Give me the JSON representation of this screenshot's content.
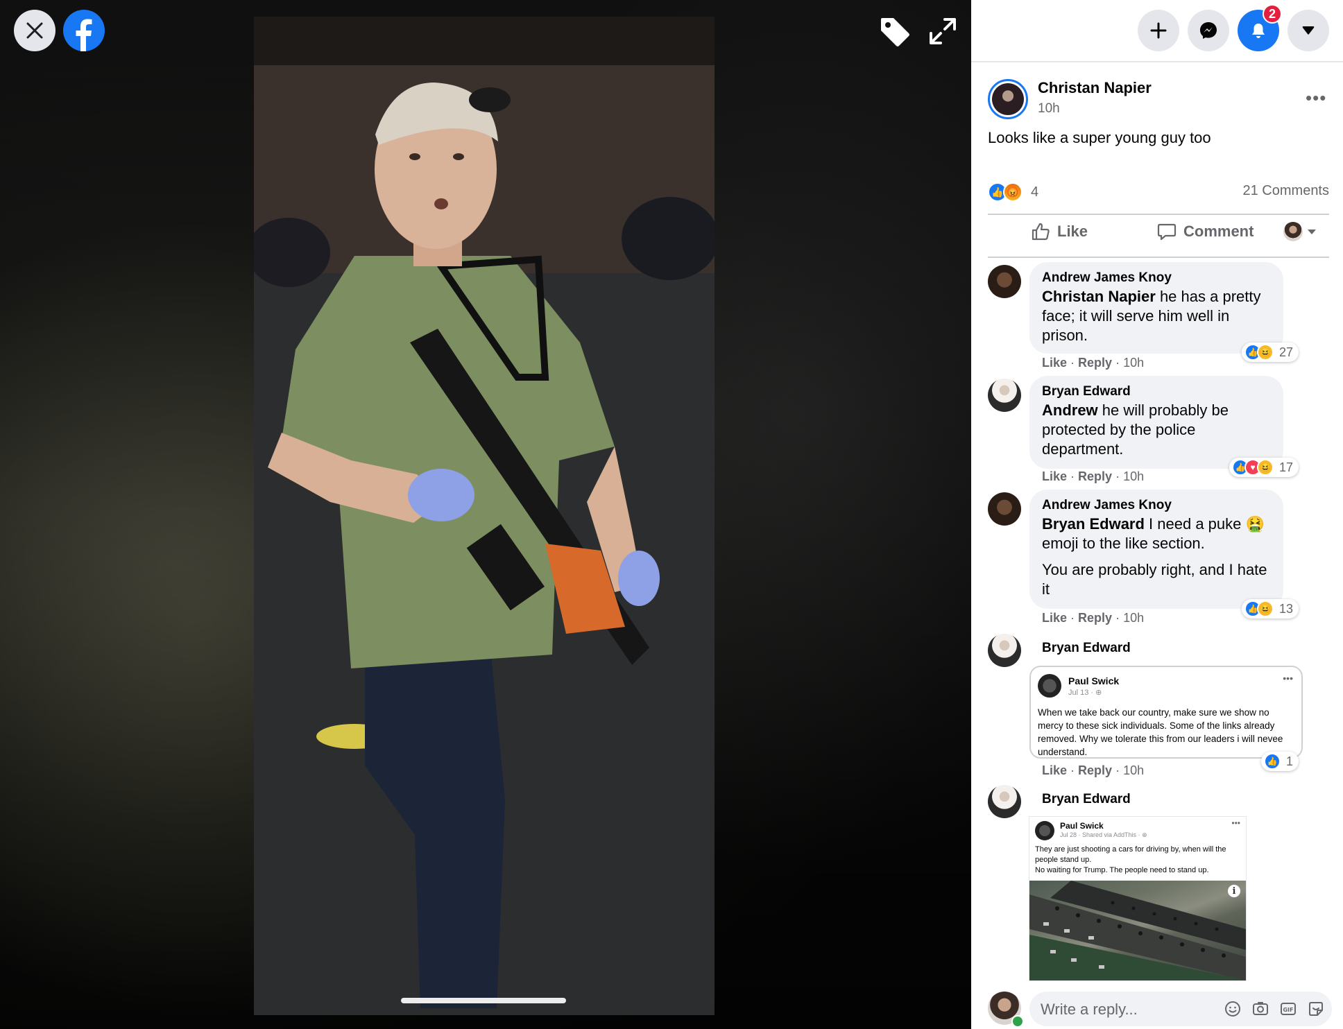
{
  "viewer": {
    "close_icon": "close-icon",
    "logo_icon": "facebook-logo-icon",
    "tag_icon": "tag-icon",
    "expand_icon": "expand-icon"
  },
  "topnav": {
    "notifications_count": "2",
    "icons": [
      "plus-icon",
      "messenger-icon",
      "bell-icon",
      "caret-down-icon"
    ],
    "accent": "#1877f2"
  },
  "post": {
    "author": "Christan Napier",
    "time": "10h",
    "text": "Looks like a super young guy too",
    "reaction_count": "4",
    "comments_label": "21 Comments",
    "like_label": "Like",
    "comment_label": "Comment"
  },
  "comments": [
    {
      "name": "Andrew James Knoy",
      "mention": "Christan Napier",
      "text": " he has a pretty face; it will serve him well in prison.",
      "like": "Like",
      "reply": "Reply",
      "time": "10h",
      "reactions": "27"
    },
    {
      "name": "Bryan Edward",
      "mention": "Andrew",
      "text": " he will probably be protected by the police department.",
      "like": "Like",
      "reply": "Reply",
      "time": "10h",
      "reactions": "17"
    },
    {
      "name": "Andrew James Knoy",
      "mention": "Bryan Edward",
      "text": " I need a puke 🤮 emoji to the like section.",
      "text2": "You are probably right, and I hate it",
      "like": "Like",
      "reply": "Reply",
      "time": "10h",
      "reactions": "13"
    },
    {
      "name": "Bryan Edward",
      "like": "Like",
      "reply": "Reply",
      "time": "10h",
      "reactions": "1",
      "screenshot": {
        "author": "Paul Swick",
        "date": "Jul 13 · ",
        "text": "When we take back our country, make sure we show no mercy to these sick individuals. Some of the links already removed. Why we tolerate this from our leaders i will nevee understand."
      }
    },
    {
      "name": "Bryan Edward",
      "screenshot": {
        "author": "Paul Swick",
        "date": "Jul 28 · Shared via AddThis · ",
        "text": "They are just shooting a cars for driving by, when will the people stand up.",
        "text2": "No waiting for Trump. The people need to stand up."
      }
    }
  ],
  "reply": {
    "placeholder": "Write a reply..."
  }
}
